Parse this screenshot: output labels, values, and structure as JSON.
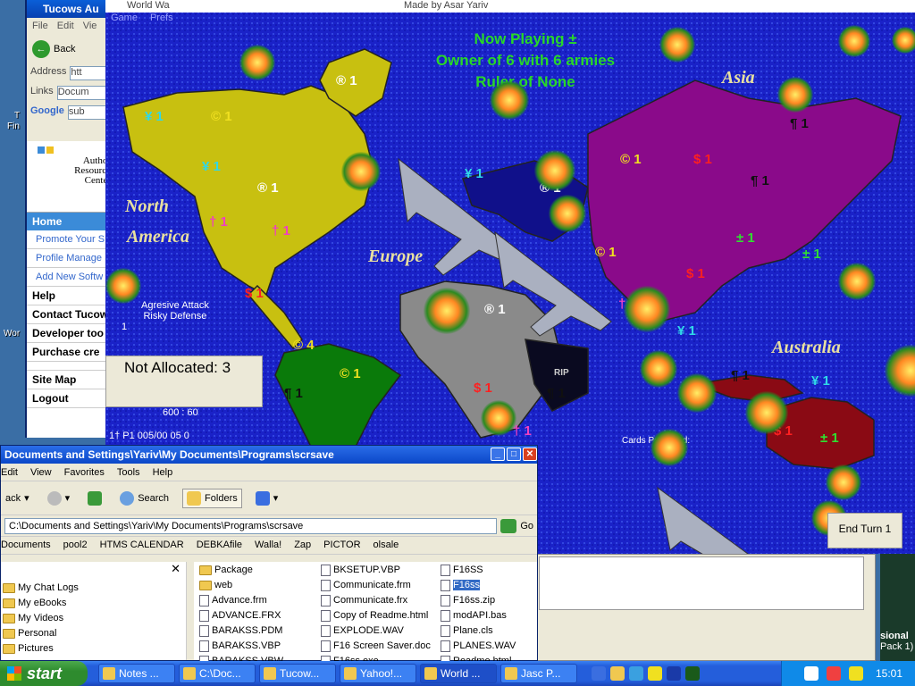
{
  "desktop": {
    "left_icon_labels": [
      "T",
      "Fin",
      "Wor"
    ]
  },
  "browser": {
    "title": "Tucows Au",
    "menu": [
      "File",
      "Edit",
      "Vie"
    ],
    "back_label": "Back",
    "address_label": "Address",
    "address_value": "htt",
    "links_label": "Links",
    "links_value": "Docum",
    "google_value": "sub",
    "logo_lines": [
      "Author",
      "Resource",
      "Center"
    ],
    "nav_home": "Home",
    "nav_sub": [
      "Promote Your S",
      "Profile Manage",
      "Add New Softw"
    ],
    "nav_main": [
      "Help",
      "Contact Tucow",
      "Developer too",
      "Purchase cre"
    ],
    "nav_bottom": [
      "Site Map",
      "Logout"
    ]
  },
  "game": {
    "title": "World Wa",
    "made_by": "Made by Asar Yariv",
    "menu": [
      "Game",
      "Prefs"
    ],
    "status_lines": [
      "Now Playing ±",
      "Owner of 6 with 6 armies",
      "Ruler of None"
    ],
    "continents": [
      "North",
      "America",
      "Europe",
      "Asia",
      "Australia"
    ],
    "strategy": [
      "Agresive Attack",
      "Risky Defense"
    ],
    "small_one": "1",
    "not_allocated": "Not Allocated: 3",
    "coords": "600 : 60",
    "player_line": "1† P1 005/00 05 0",
    "rip_label": "RIP",
    "cards_label": "Cards Possesed:",
    "end_turn": "End Turn 1",
    "territory_labels": [
      {
        "text": "¥ 1",
        "color": "#30d8e8"
      },
      {
        "text": "© 1",
        "color": "#f0e020"
      },
      {
        "text": "® 1",
        "color": "#ffffff"
      },
      {
        "text": "¥ 1",
        "color": "#30d8e8"
      },
      {
        "text": "® 1",
        "color": "#ffffff"
      },
      {
        "text": "† 1",
        "color": "#f040c0"
      },
      {
        "text": "† 1",
        "color": "#f040c0"
      },
      {
        "text": "$ 1",
        "color": "#ff2020"
      },
      {
        "text": "© 4",
        "color": "#f0e020"
      },
      {
        "text": "© 1",
        "color": "#f0e020"
      },
      {
        "text": "¶ 1",
        "color": "#101010"
      },
      {
        "text": "® 1",
        "color": "#ffffff"
      },
      {
        "text": "® 1",
        "color": "#ffffff"
      },
      {
        "text": "$ 1",
        "color": "#ff2020"
      },
      {
        "text": "† 1",
        "color": "#f040c0"
      },
      {
        "text": "¥ 1",
        "color": "#30d8e8"
      },
      {
        "text": "© 1",
        "color": "#f0e020"
      },
      {
        "text": "© 1",
        "color": "#f0e020"
      },
      {
        "text": "$ 1",
        "color": "#ff2020"
      },
      {
        "text": "¶ 1",
        "color": "#101010"
      },
      {
        "text": "¶ 1",
        "color": "#101010"
      },
      {
        "text": "± 1",
        "color": "#30e030"
      },
      {
        "text": "± 1",
        "color": "#30e030"
      },
      {
        "text": "$ 1",
        "color": "#ff2020"
      },
      {
        "text": "† 1",
        "color": "#f040c0"
      },
      {
        "text": "¥ 1",
        "color": "#30d8e8"
      },
      {
        "text": "¶ 1",
        "color": "#101010"
      },
      {
        "text": "¥ 1",
        "color": "#30d8e8"
      },
      {
        "text": "$ 1",
        "color": "#ff2020"
      },
      {
        "text": "± 1",
        "color": "#30e030"
      },
      {
        "text": "¶ 1",
        "color": "#101010"
      }
    ]
  },
  "explorer": {
    "title": "Documents and Settings\\Yariv\\My Documents\\Programs\\scrsave",
    "menu": [
      "Edit",
      "View",
      "Favorites",
      "Tools",
      "Help"
    ],
    "back_label": "ack",
    "search_label": "Search",
    "folders_label": "Folders",
    "address_value": "C:\\Documents and Settings\\Yariv\\My Documents\\Programs\\scrsave",
    "go_label": "Go",
    "links": [
      "Documents",
      "pool2",
      "HTMS CALENDAR",
      "DEBKAfile",
      "Walla!",
      "Zap",
      "PICTOR",
      "olsale"
    ],
    "left_items": [
      "My Chat Logs",
      "My eBooks",
      "My Videos",
      "Personal",
      "Pictures"
    ],
    "files_col1": [
      "Package",
      "web",
      "Advance.frm",
      "ADVANCE.FRX",
      "BARAKSS.PDM",
      "BARAKSS.VBP",
      "BARAKSS.VBW"
    ],
    "files_col2": [
      "BKSETUP.VBP",
      "Communicate.frm",
      "Communicate.frx",
      "Copy of Readme.html",
      "EXPLODE.WAV",
      "F16 Screen Saver.doc",
      "F16ss.exe"
    ],
    "files_col3": [
      "F16SS",
      "F16ss",
      "F16ss.zip",
      "modAPI.bas",
      "Plane.cls",
      "PLANES.WAV",
      "Readme.html"
    ]
  },
  "right_partial": {
    "lines": [
      "sional",
      "Pack 1)"
    ]
  },
  "taskbar": {
    "start": "start",
    "tasks": [
      "Notes ...",
      "C:\\Doc...",
      "Tucow...",
      "Yahoo!...",
      "World ...",
      "Jasc P..."
    ],
    "clock": "15:01"
  },
  "colors": {
    "ocean": "#1a22c8",
    "north_america": "#c8c010",
    "south_america": "#0a7a0a",
    "africa": "#8a8a8a",
    "asia": "#8a0a8a",
    "australia": "#8a0a14",
    "europe_north": "#10108a"
  }
}
